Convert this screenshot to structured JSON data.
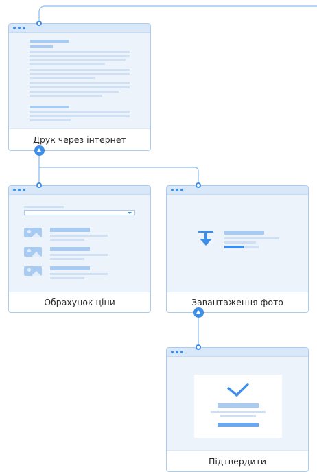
{
  "colors": {
    "accent": "#3e8ee8",
    "card_border": "#a9cdf1",
    "card_fill": "#eef4fc"
  },
  "nodes": [
    {
      "id": "print-online",
      "label": "Друк через інтернет"
    },
    {
      "id": "price-calc",
      "label": "Обрахунок ціни"
    },
    {
      "id": "photo-upload",
      "label": "Завантаження фото"
    },
    {
      "id": "confirm",
      "label": "Підтвердити"
    }
  ],
  "icons": {
    "download": "download-arrow-icon",
    "check": "checkmark-icon",
    "dropdown": "chevron-down-icon",
    "image": "image-placeholder-icon"
  }
}
